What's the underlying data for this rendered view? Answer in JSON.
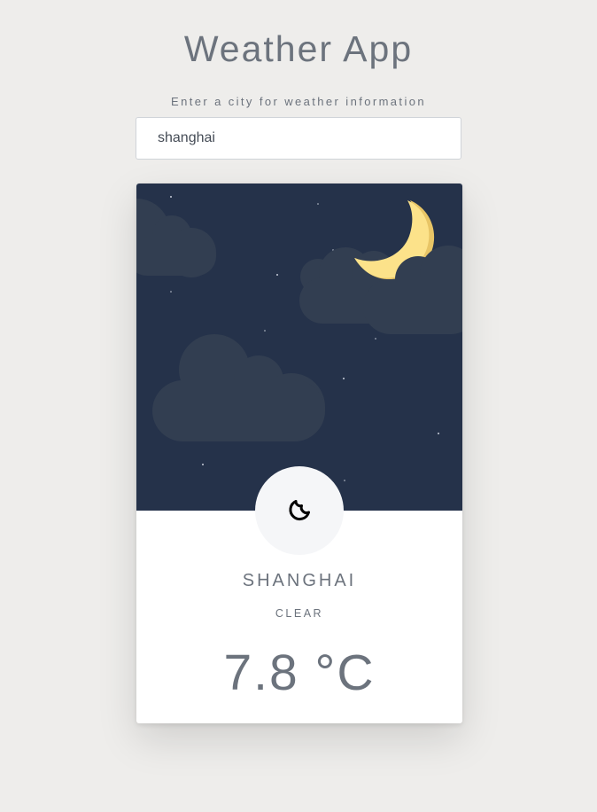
{
  "header": {
    "title": "Weather App"
  },
  "search": {
    "label": "Enter a city for weather information",
    "value": "shanghai"
  },
  "weather_card": {
    "scene": "night-clouds-moon",
    "icon": "moon-icon",
    "city": "SHANGHAI",
    "condition": "CLEAR",
    "temperature": "7.8 °C"
  },
  "colors": {
    "background": "#eeedeb",
    "text": "#6c737d",
    "sky": "#25324a",
    "cloud": "#323e51",
    "moon": "#fce28a",
    "icon_circle": "#f5f6f8"
  }
}
